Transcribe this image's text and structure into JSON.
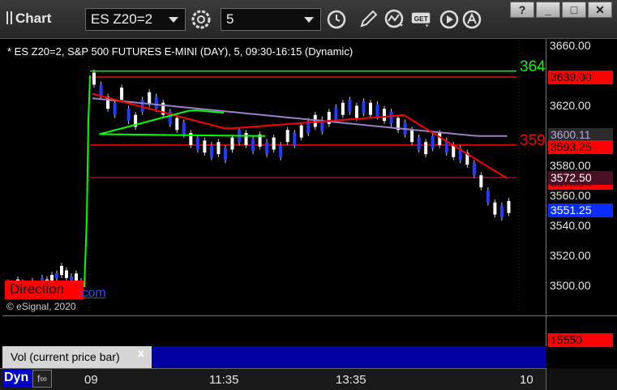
{
  "app": {
    "title": "Chart"
  },
  "toolbar": {
    "symbol": "ES Z20=2",
    "interval": "5",
    "buttons": [
      "gear-icon",
      "clock-icon",
      "pencil-icon",
      "study-icon",
      "get-icon",
      "play-icon",
      "annotate-icon"
    ]
  },
  "window_buttons": {
    "help": "?",
    "minimize": "_",
    "maximize": "□",
    "close": "✕"
  },
  "chart_header": "* ES Z20=2, S&P 500 FUTURES E-MINI (DAY), 5, 09:30-16:15 (Dynamic)",
  "copyright": "© eSignal, 2020",
  "direction_text": "Direction",
  "direction_link": ".com",
  "price_axis": {
    "ticks": [
      "3660.00",
      "3640.00",
      "3620.00",
      "3600.00",
      "3580.00",
      "3560.00",
      "3540.00",
      "3520.00",
      "3500.00"
    ]
  },
  "level_tags": {
    "green_line_text": "364",
    "red_top": "3639.00",
    "purple_ma": "3600.11",
    "red_mid_text": "359",
    "red_mid": "3593.25",
    "red_ma": "3570.16",
    "maroon_line": "3572.50",
    "last_price": "3551.25"
  },
  "volume": {
    "label": "Vol (current price bar)",
    "close": "x",
    "last": "15550"
  },
  "time_axis": {
    "labels": [
      "09",
      "11:35",
      "13:35",
      "10"
    ]
  },
  "bottom": {
    "dyn": "Dyn",
    "link": "f∞"
  },
  "colors": {
    "green": "#00ff00",
    "red": "#ff0000",
    "blue": "#1f3cff",
    "purple_ma": "#9a7fc9",
    "maroon": "#7a1a3a",
    "last_price_bg": "#0a2cff",
    "volume_bar_bg": "#0000a0"
  }
}
